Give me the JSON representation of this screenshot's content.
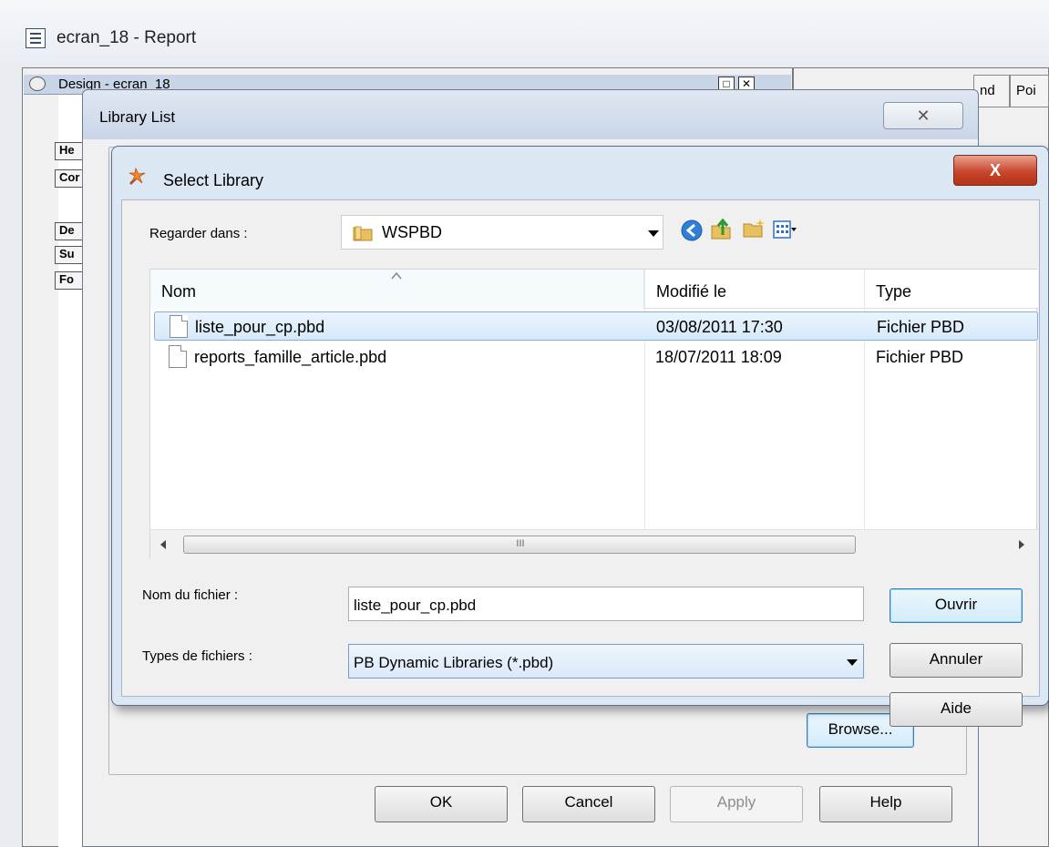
{
  "app": {
    "title": "ecran_18  - Report",
    "design_pane_label": "Design - ecran_18",
    "band_labels": [
      "He",
      "Cor",
      "De",
      "Su",
      "Fo"
    ],
    "right_tabs": [
      "nd",
      "Poi"
    ]
  },
  "library_list": {
    "title": "Library List",
    "close_glyph": "✕",
    "browse_label": "Browse...",
    "buttons": {
      "ok": "OK",
      "cancel": "Cancel",
      "apply": "Apply",
      "help": "Help"
    }
  },
  "select_library": {
    "title": "Select Library",
    "close_glyph": "X",
    "look_in_label": "Regarder dans :",
    "look_in_value": "WSPBD",
    "columns": {
      "name": "Nom",
      "modified": "Modifié le",
      "type": "Type"
    },
    "files": [
      {
        "name": "liste_pour_cp.pbd",
        "modified": "03/08/2011 17:30",
        "type": "Fichier PBD",
        "selected": true
      },
      {
        "name": "reports_famille_article.pbd",
        "modified": "18/07/2011 18:09",
        "type": "Fichier PBD",
        "selected": false
      }
    ],
    "scroll_grip": "III",
    "filename_label": "Nom du fichier :",
    "filename_value": "liste_pour_cp.pbd",
    "filetype_label": "Types de fichiers :",
    "filetype_value": "PB Dynamic Libraries (*.pbd)",
    "buttons": {
      "open": "Ouvrir",
      "cancel": "Annuler",
      "help": "Aide"
    },
    "colors": {
      "accent": "#3399ff",
      "selection": "#d6e9f9",
      "close_red": "#c9462c"
    },
    "icons": [
      "select-library-icon",
      "folder-icon",
      "back-icon",
      "up-folder-icon",
      "new-folder-icon",
      "view-menu-icon",
      "file-icon"
    ]
  }
}
